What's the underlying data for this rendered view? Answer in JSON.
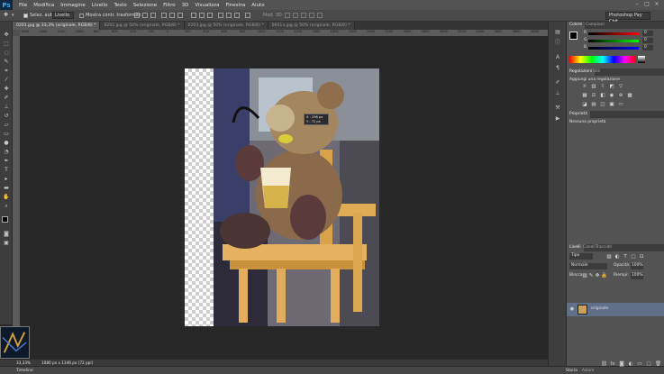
{
  "menubar": {
    "logo": "Ps",
    "items": [
      "File",
      "Modifica",
      "Immagine",
      "Livello",
      "Testo",
      "Selezione",
      "Filtro",
      "3D",
      "Visualizza",
      "Finestra",
      "Aiuto"
    ]
  },
  "options": {
    "autoselect_label": "Selez. auto:",
    "autoselect_value": "Livello",
    "transform_label": "Mostra contr. trasformaz.",
    "mode3d_label": "Mod. 3D:",
    "workspace": "Photoshop Pay Chit"
  },
  "tabs": [
    {
      "label": "0201.jpg @ 33,3% (originale, RGB/8) *",
      "active": true
    },
    {
      "label": "0202.jpg @ 50% (originale, RGB/8) *",
      "active": false
    },
    {
      "label": "0203.jpg @ 50% (originale, RGB/8) *",
      "active": false
    },
    {
      "label": "0601a.jpg @ 50% (originale, RGB/8) *",
      "active": false
    }
  ],
  "ruler": {
    "labels": [
      "1600",
      "1400",
      "1200",
      "1000",
      "800",
      "600",
      "400",
      "200",
      "0",
      "200",
      "400",
      "600",
      "800",
      "1000",
      "1200",
      "1400",
      "1600",
      "1800",
      "2000",
      "2200",
      "2400",
      "2600",
      "2800",
      "3000",
      "3200",
      "3400",
      "3600",
      "3800",
      "4000"
    ]
  },
  "canvas": {
    "tooltip_x": "X : 298 px",
    "tooltip_y": "Y : 72 px"
  },
  "status": {
    "zoom": "33,33%",
    "doc_info": "1080 px x 1346 px (72 ppi)",
    "timeline": "Timeline"
  },
  "color_panel": {
    "tab_colore": "Colore",
    "tab_campioni": "Campioni",
    "r_label": "R",
    "g_label": "G",
    "b_label": "B",
    "r_value": "0",
    "g_value": "0",
    "b_value": "0"
  },
  "adjust_panel": {
    "tab_regolazioni": "Regolazioni",
    "tab_stili": "Stili",
    "heading": "Aggiungi una regolazione"
  },
  "properties_panel": {
    "tab": "Proprietà",
    "message": "Nessuna proprietà"
  },
  "layers_panel": {
    "tab_livelli": "Livelli",
    "tab_canali": "Canali",
    "tab_tracciati": "Tracciati",
    "kind": "Tipo",
    "blend_mode": "Normale",
    "opacity_label": "Opacità:",
    "opacity_value": "100%",
    "lock_label": "Blocca:",
    "fill_label": "Riempi:",
    "fill_value": "100%",
    "layer_name": "originale"
  },
  "bottom_tabs": {
    "storia": "Storia",
    "azioni": "Azioni"
  },
  "colors": {
    "accent_blue": "#0c2a44",
    "layer_selected": "#5f7088"
  }
}
